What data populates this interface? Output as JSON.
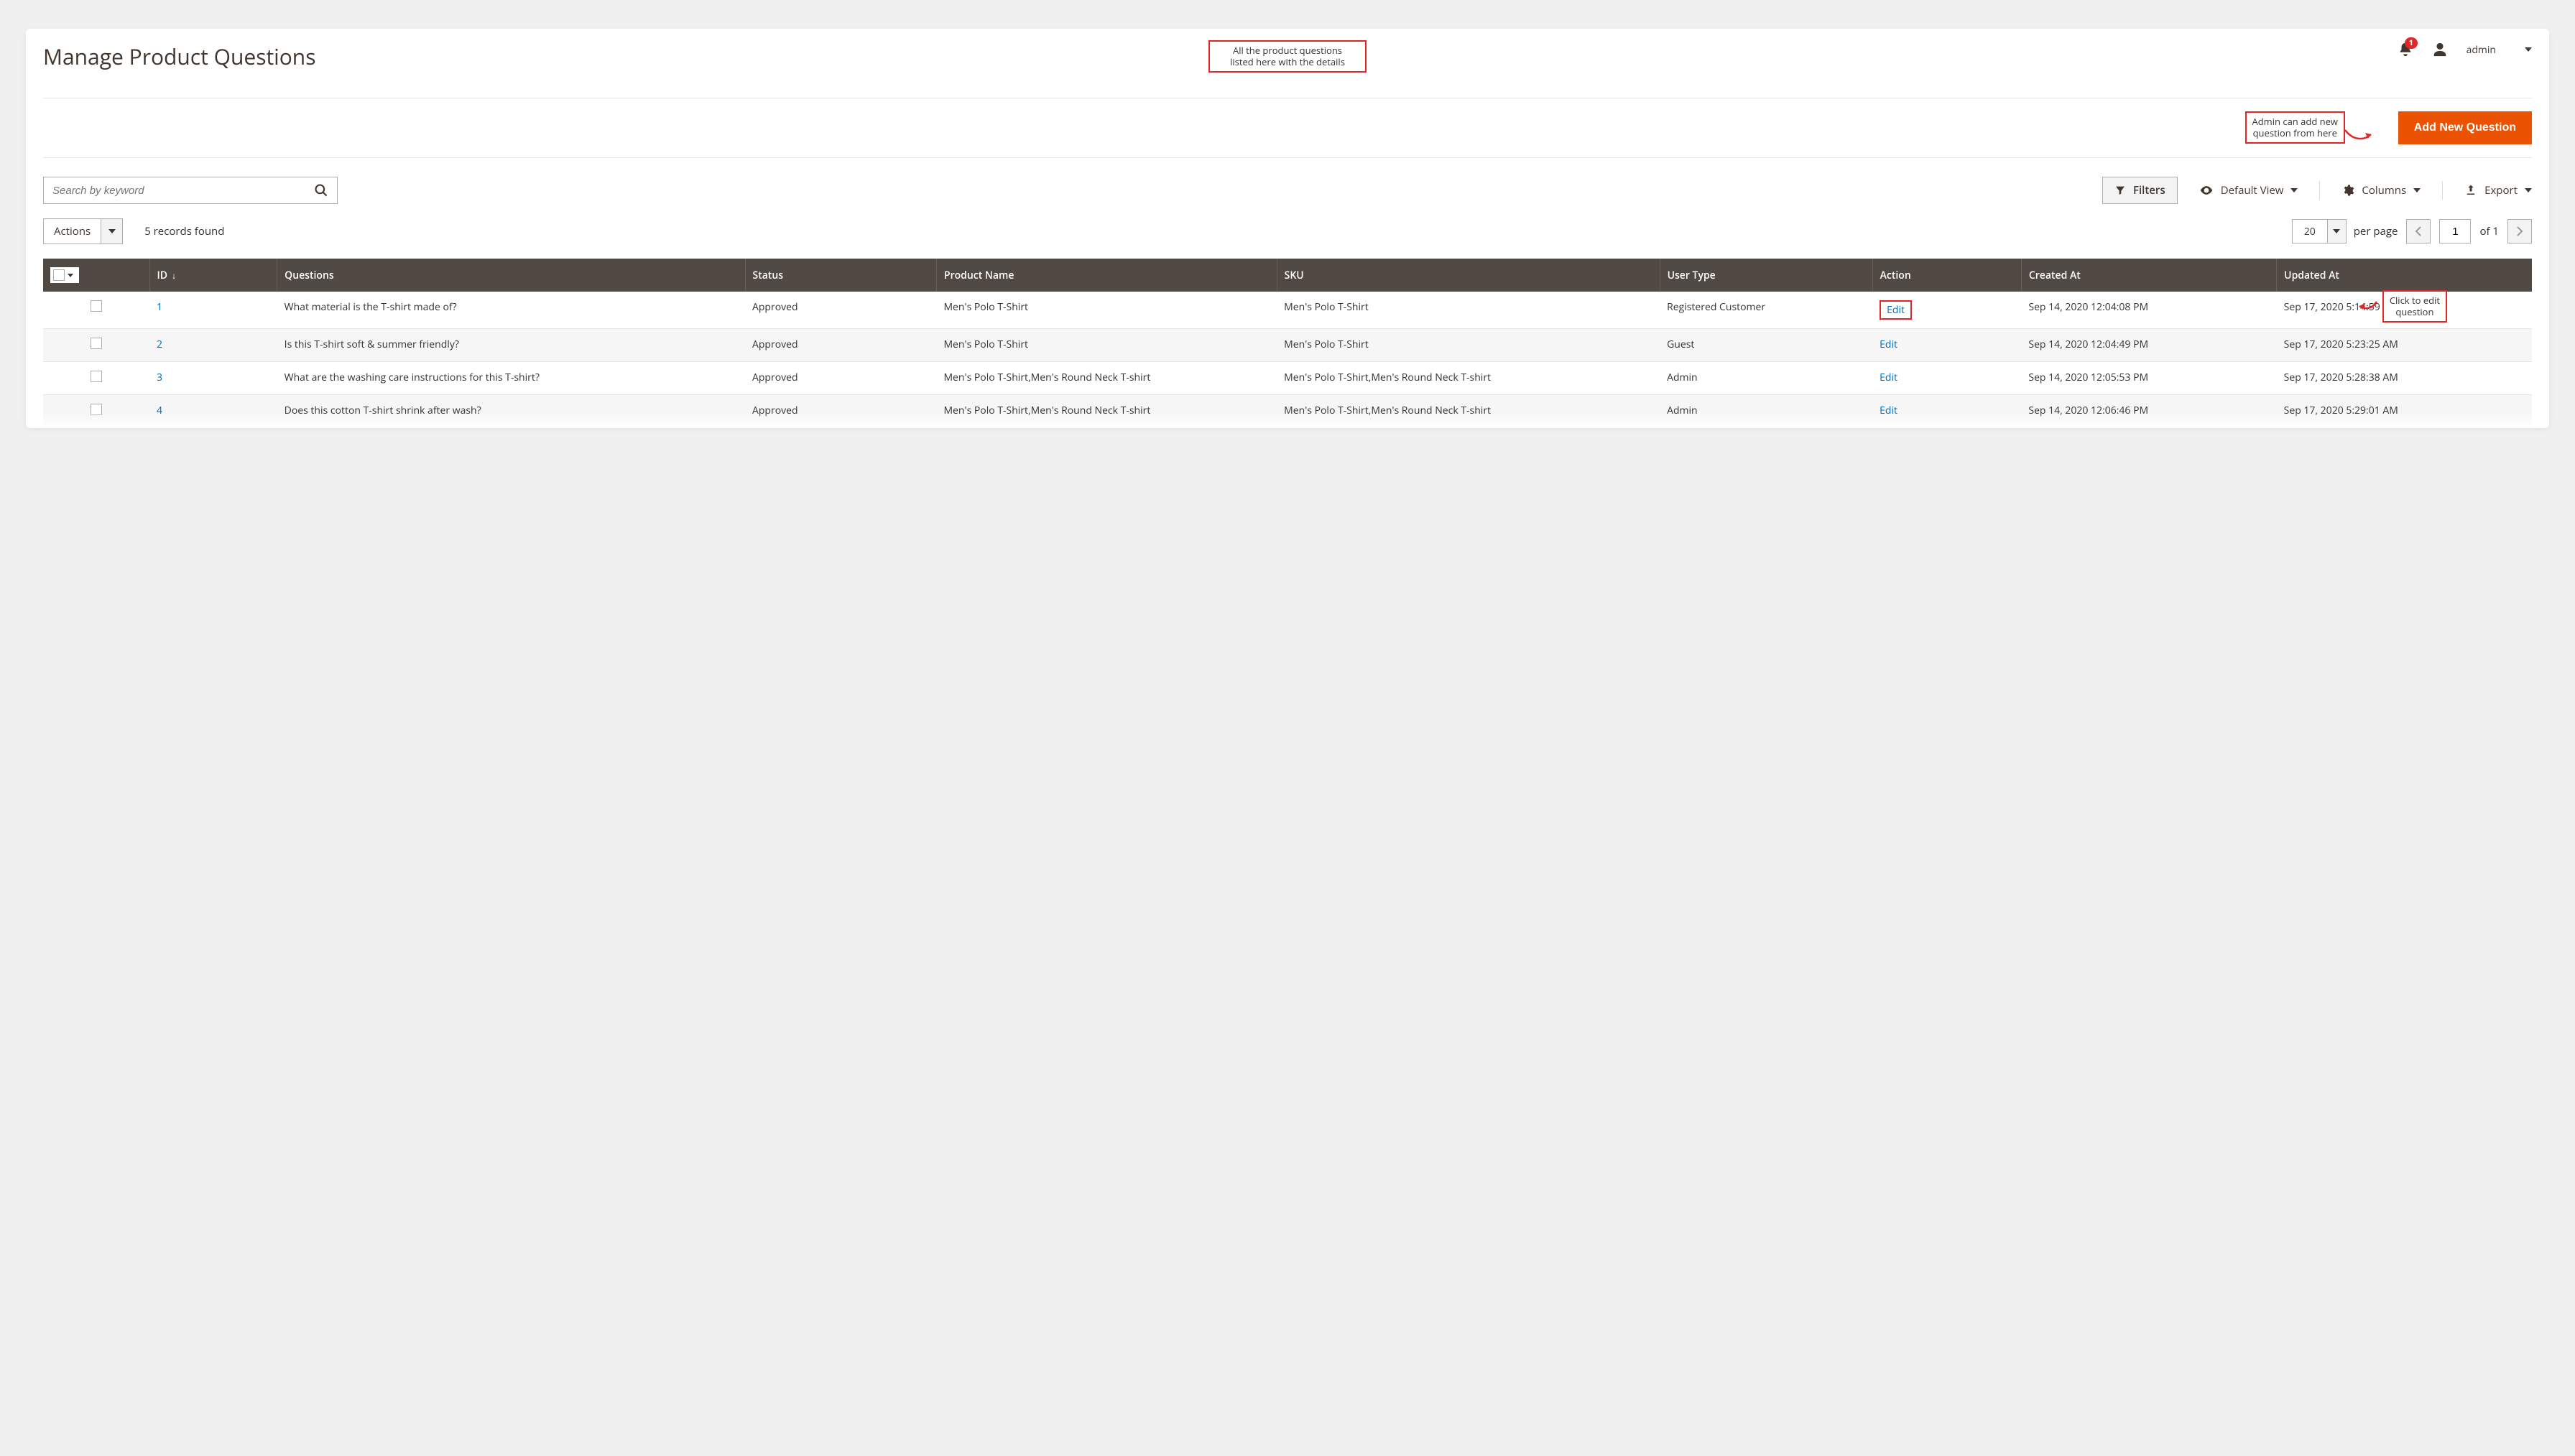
{
  "header": {
    "title": "Manage Product Questions",
    "notification_count": "1",
    "username": "admin",
    "annotation_listing": "All the product questions\nlisted here with the details"
  },
  "actionbar": {
    "add_button": "Add New Question",
    "annotation_add": "Admin can add new\nquestion from here"
  },
  "tools": {
    "search_placeholder": "Search by keyword",
    "filters": "Filters",
    "default_view": "Default View",
    "columns": "Columns",
    "export": "Export"
  },
  "meta": {
    "actions_label": "Actions",
    "records_found": "5 records found",
    "page_size": "20",
    "per_page_label": "per page",
    "page_current": "1",
    "page_total": "of 1"
  },
  "grid": {
    "columns": {
      "id": "ID",
      "questions": "Questions",
      "status": "Status",
      "product_name": "Product Name",
      "sku": "SKU",
      "user_type": "User Type",
      "action": "Action",
      "created_at": "Created At",
      "updated_at": "Updated At"
    },
    "edit_label": "Edit",
    "annotation_edit": "Click to edit\nquestion",
    "rows": [
      {
        "id": "1",
        "question": "What material is the T-shirt made of?",
        "status": "Approved",
        "product": "Men's Polo T-Shirt",
        "sku": "Men's Polo T-Shirt",
        "user_type": "Registered Customer",
        "created": "Sep 14, 2020 12:04:08 PM",
        "updated": "Sep 17, 2020 5:14:59 AM"
      },
      {
        "id": "2",
        "question": "Is this T-shirt soft & summer friendly?",
        "status": "Approved",
        "product": "Men's Polo T-Shirt",
        "sku": "Men's Polo T-Shirt",
        "user_type": "Guest",
        "created": "Sep 14, 2020 12:04:49 PM",
        "updated": "Sep 17, 2020 5:23:25 AM"
      },
      {
        "id": "3",
        "question": "What are the washing care instructions for this T-shirt?",
        "status": "Approved",
        "product": "Men's Polo T-Shirt,Men's Round Neck T-shirt",
        "sku": "Men's Polo T-Shirt,Men's Round Neck T-shirt",
        "user_type": "Admin",
        "created": "Sep 14, 2020 12:05:53 PM",
        "updated": "Sep 17, 2020 5:28:38 AM"
      },
      {
        "id": "4",
        "question": "Does this cotton T-shirt shrink after wash?",
        "status": "Approved",
        "product": "Men's Polo T-Shirt,Men's Round Neck T-shirt",
        "sku": "Men's Polo T-Shirt,Men's Round Neck T-shirt",
        "user_type": "Admin",
        "created": "Sep 14, 2020 12:06:46 PM",
        "updated": "Sep 17, 2020 5:29:01 AM"
      }
    ]
  }
}
